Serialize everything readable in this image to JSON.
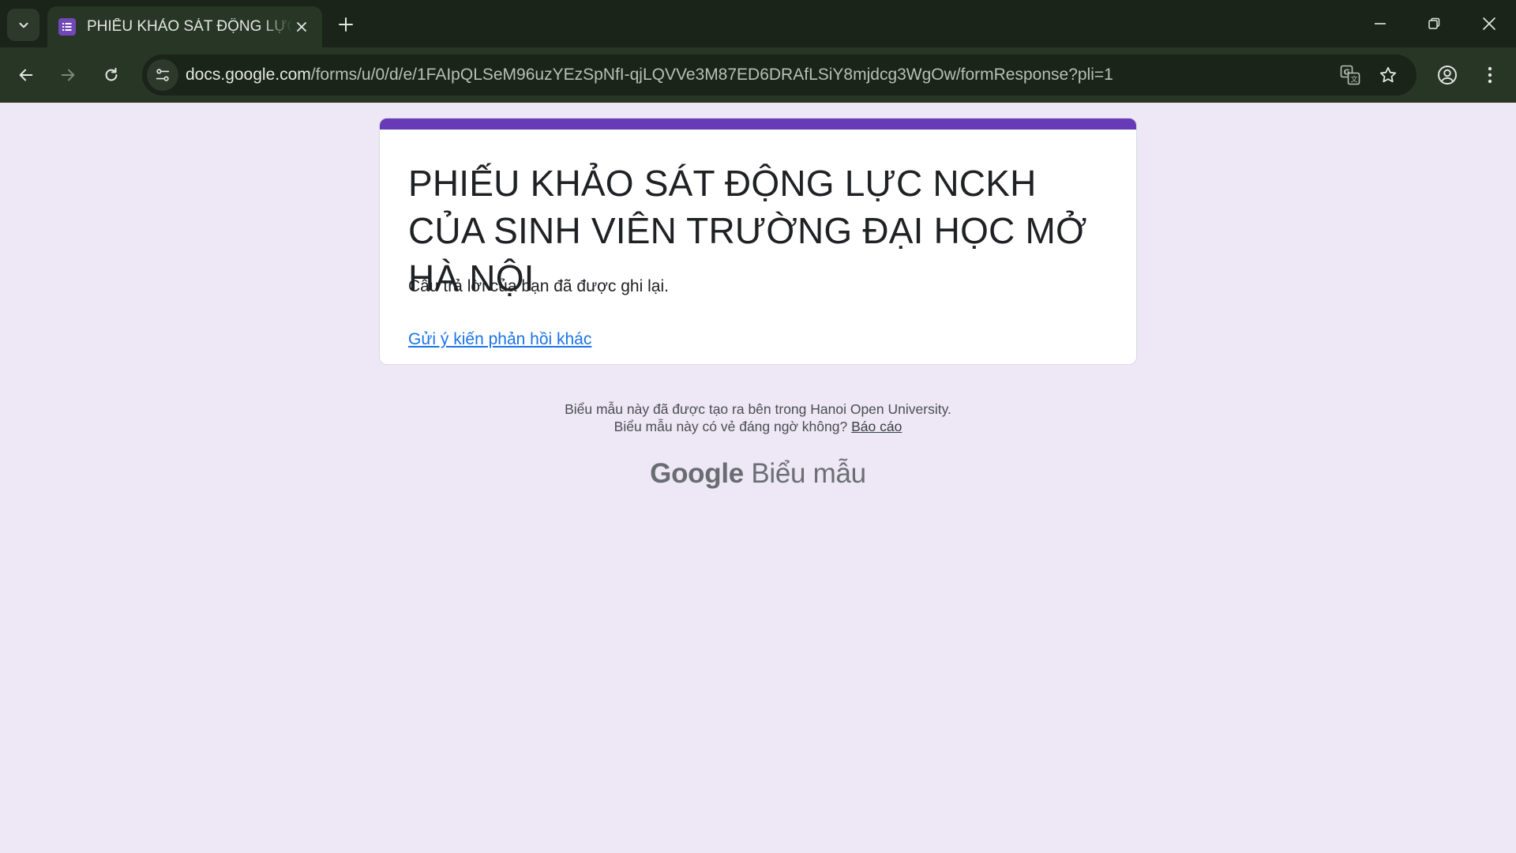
{
  "browser": {
    "tab_title": "PHIẾU KHẢO SÁT ĐỘNG LỰC NCKH CỦA SINH VIÊN TRƯỜNG ĐẠI HỌC MỞ HÀ NỘI",
    "url_host": "docs.google.com",
    "url_path": "/forms/u/0/d/e/1FAIpQLSeM96uzYEzSpNfI-qjLQVVe3M87ED6DRAfLSiY8mjdcg3WgOw/formResponse?pli=1",
    "icons": [
      "tab-search-icon",
      "forms-favicon",
      "close-tab-icon",
      "new-tab-icon",
      "minimize-icon",
      "restore-icon",
      "close-window-icon",
      "back-icon",
      "forward-icon",
      "reload-icon",
      "site-info-icon",
      "translate-icon",
      "bookmark-star-icon",
      "profile-icon",
      "menu-icon"
    ],
    "colors": {
      "tabbar": "#1a2418",
      "toolbar": "#283626"
    }
  },
  "form": {
    "title": "PHIẾU KHẢO SÁT ĐỘNG LỰC NCKH CỦA SINH VIÊN TRƯỜNG ĐẠI HỌC MỞ HÀ NỘI",
    "confirmation": "Câu trả lời của bạn đã được ghi lại.",
    "submit_another_link": "Gửi ý kiến phản hồi khác",
    "accent_color": "#673ab7"
  },
  "footer": {
    "created_in": "Biểu mẫu này đã được tạo ra bên trong Hanoi Open University.",
    "suspicious_prompt": "Biểu mẫu này có vẻ đáng ngờ không?",
    "report_link": "Báo cáo",
    "brand_google": "Google",
    "brand_product": "Biểu mẫu"
  }
}
